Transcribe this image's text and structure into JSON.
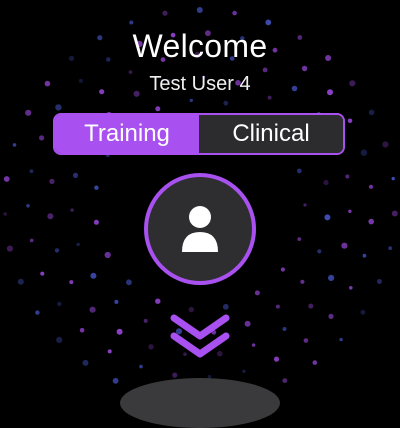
{
  "header": {
    "title": "Welcome",
    "user_name": "Test User 4"
  },
  "mode_toggle": {
    "options": [
      "Training",
      "Clinical"
    ],
    "selected": "Training"
  },
  "colors": {
    "accent": "#a851f0",
    "inactive_segment": "#2c2c2e",
    "background": "#000000",
    "dot_blue": "#4a5bd6",
    "dot_purple": "#a24be8"
  },
  "icons": {
    "avatar": "user-icon",
    "scroll": "double-chevron-down-icon"
  }
}
